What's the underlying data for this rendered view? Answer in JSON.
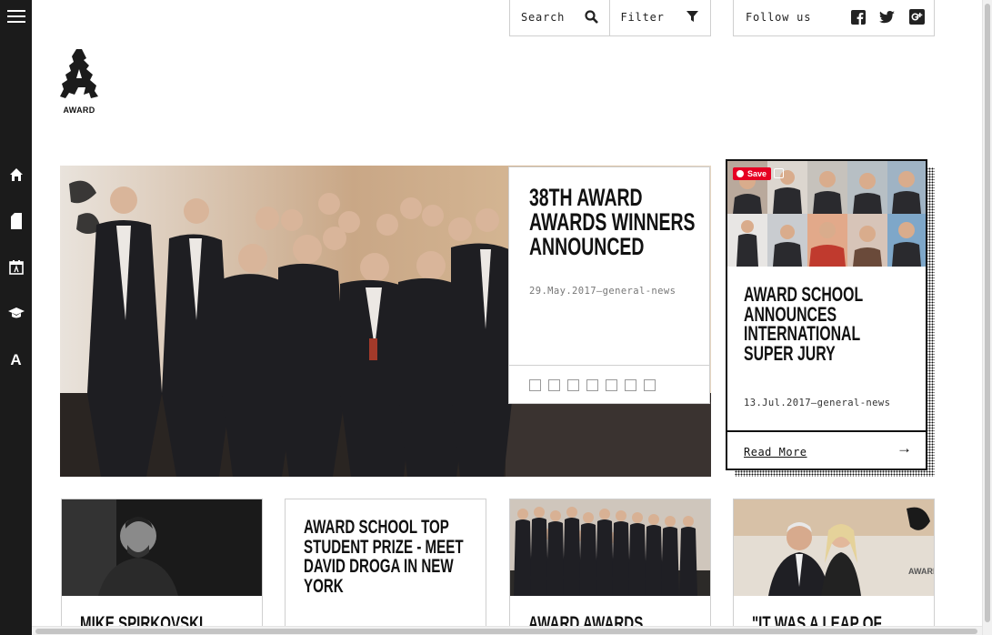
{
  "sidebar": {
    "menu_icon": "hamburger-menu-icon",
    "items": [
      {
        "icon": "home-icon"
      },
      {
        "icon": "document-icon"
      },
      {
        "icon": "calendar-icon"
      },
      {
        "icon": "graduation-cap-icon"
      },
      {
        "icon": "award-logo-icon",
        "glyph": "A"
      }
    ]
  },
  "header": {
    "search_label": "Search",
    "filter_label": "Filter",
    "follow_label": "Follow us",
    "social": [
      "facebook-icon",
      "twitter-icon",
      "google-plus-icon"
    ]
  },
  "logo": {
    "text": "AWARD"
  },
  "hero": {
    "title": "38TH AWARD AWARDS WINNERS ANNOUNCED",
    "meta": "29.May.2017—general-news",
    "slides": 7
  },
  "side_card": {
    "title": "AWARD SCHOOL ANNOUNCES INTERNATIONAL SUPER JURY",
    "meta": "13.Jul.2017—general-news",
    "read_more": "Read More",
    "arrow": "→",
    "save_label": "Save"
  },
  "tiles": [
    {
      "title": "MIKE SPIRKOVSKI"
    },
    {
      "title": "AWARD SCHOOL TOP STUDENT PRIZE - MEET DAVID DROGA IN NEW YORK"
    },
    {
      "title": "AWARD AWARDS AGENCY"
    },
    {
      "title": "\"IT WAS A LEAP OF FAITH",
      "image_text": "AWARD"
    }
  ],
  "colors": {
    "sidebar_bg": "#1b1b1b",
    "border": "#cfcfcf",
    "pinterest_red": "#e60023"
  }
}
